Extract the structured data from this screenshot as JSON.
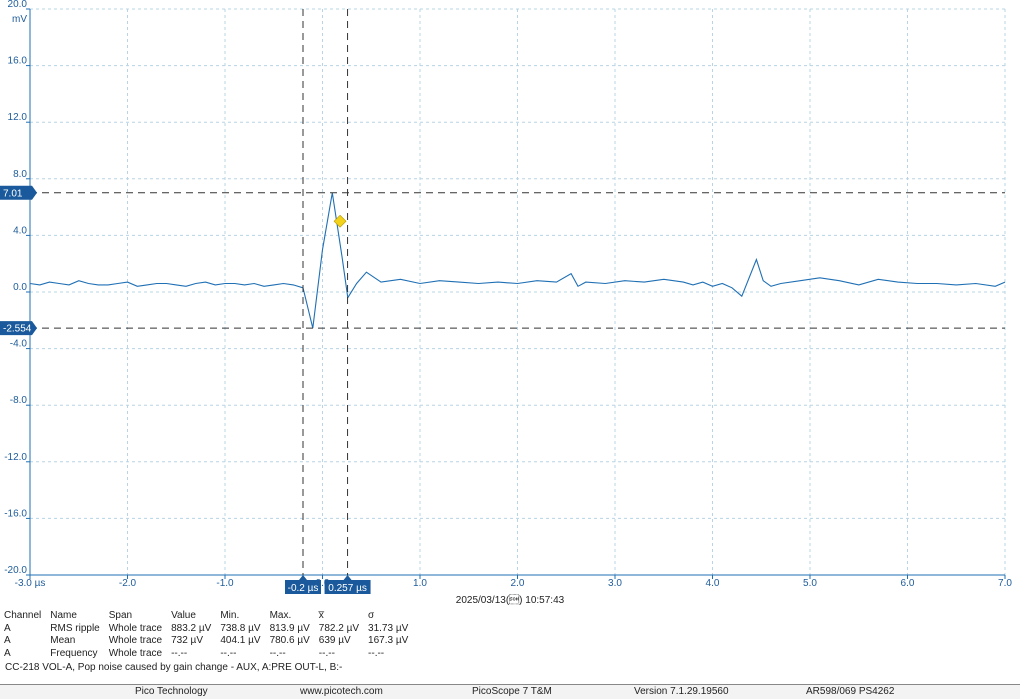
{
  "chart_data": {
    "type": "line",
    "y_unit": "mV",
    "x_unit": "µs",
    "xlim": [
      -3.0,
      7.0
    ],
    "ylim": [
      -20.0,
      20.0
    ],
    "x_ticks": [
      "-3.0 µs",
      "-2.0",
      "-1.0",
      "0.0",
      "1.0",
      "2.0",
      "3.0",
      "4.0",
      "5.0",
      "6.0",
      "7.0"
    ],
    "y_ticks": [
      "20.0",
      "16.0",
      "12.0",
      "8.0",
      "4.0",
      "0.0",
      "-4.0",
      "-8.0",
      "-12.0",
      "-16.0",
      "-20.0"
    ],
    "grid": true,
    "series": [
      {
        "color": "#1f6fb4",
        "x": [
          -3.0,
          -2.9,
          -2.8,
          -2.7,
          -2.6,
          -2.5,
          -2.4,
          -2.3,
          -2.2,
          -2.1,
          -2.0,
          -1.9,
          -1.8,
          -1.7,
          -1.6,
          -1.5,
          -1.4,
          -1.3,
          -1.2,
          -1.1,
          -1.0,
          -0.9,
          -0.8,
          -0.7,
          -0.6,
          -0.5,
          -0.4,
          -0.3,
          -0.2,
          -0.1,
          0.0,
          0.1,
          0.2,
          0.26,
          0.35,
          0.45,
          0.6,
          0.8,
          1.0,
          1.2,
          1.4,
          1.6,
          1.8,
          2.0,
          2.2,
          2.4,
          2.55,
          2.62,
          2.7,
          2.9,
          3.1,
          3.3,
          3.5,
          3.7,
          3.8,
          3.9,
          4.0,
          4.1,
          4.2,
          4.3,
          4.45,
          4.52,
          4.6,
          4.7,
          4.9,
          5.1,
          5.3,
          5.5,
          5.7,
          5.9,
          6.1,
          6.3,
          6.5,
          6.7,
          6.9,
          7.0
        ],
        "y": [
          0.6,
          0.5,
          0.7,
          0.6,
          0.5,
          0.8,
          0.6,
          0.5,
          0.5,
          0.6,
          0.7,
          0.4,
          0.5,
          0.6,
          0.6,
          0.5,
          0.4,
          0.6,
          0.7,
          0.5,
          0.6,
          0.6,
          0.5,
          0.6,
          0.4,
          0.5,
          0.6,
          0.5,
          0.3,
          -2.55,
          3.0,
          7.01,
          2.5,
          -0.4,
          0.6,
          1.4,
          0.7,
          0.9,
          0.6,
          0.8,
          0.7,
          0.6,
          0.7,
          0.6,
          0.8,
          0.7,
          1.3,
          0.4,
          0.7,
          0.6,
          0.8,
          0.7,
          0.9,
          0.7,
          0.5,
          0.7,
          0.4,
          0.6,
          0.3,
          -0.3,
          2.3,
          0.8,
          0.4,
          0.6,
          0.8,
          1.0,
          0.8,
          0.5,
          0.9,
          0.7,
          0.6,
          0.6,
          0.5,
          0.6,
          0.4,
          0.7
        ]
      }
    ],
    "cursors": {
      "y": [
        7.01,
        -2.554
      ],
      "y_labels": [
        "7.01",
        "-2.554"
      ],
      "x": [
        -0.2,
        0.257
      ],
      "x_labels": [
        "-0.2 µs",
        "0.257 µs"
      ]
    },
    "marker": {
      "x": 0.18,
      "y": 5.0,
      "color": "#f2d21b"
    }
  },
  "timestamp": "2025/03/13(\u0001) 10:57:43",
  "measurements": {
    "headers": [
      "Channel",
      "Name",
      "Span",
      "Value",
      "Min.",
      "Max.",
      "x̅",
      "σ"
    ],
    "rows": [
      [
        "A",
        "RMS ripple",
        "Whole trace",
        "883.2 µV",
        "738.8 µV",
        "813.9 µV",
        "782.2 µV",
        "31.73 µV"
      ],
      [
        "A",
        "Mean",
        "Whole trace",
        "732 µV",
        "404.1 µV",
        "780.6 µV",
        "639 µV",
        "167.3 µV"
      ],
      [
        "A",
        "Frequency",
        "Whole trace",
        "--.--",
        "--.--",
        "--.--",
        "--.--",
        "--.--"
      ]
    ]
  },
  "caption": "CC-218 VOL-A, Pop noise caused by gain change - AUX, A:PRE OUT-L, B:-",
  "footer": {
    "company": "Pico Technology",
    "website": "www.picotech.com",
    "product": "PicoScope 7 T&M",
    "version": "Version 7.1.29.19560",
    "device": "AR598/069 PS4262"
  }
}
